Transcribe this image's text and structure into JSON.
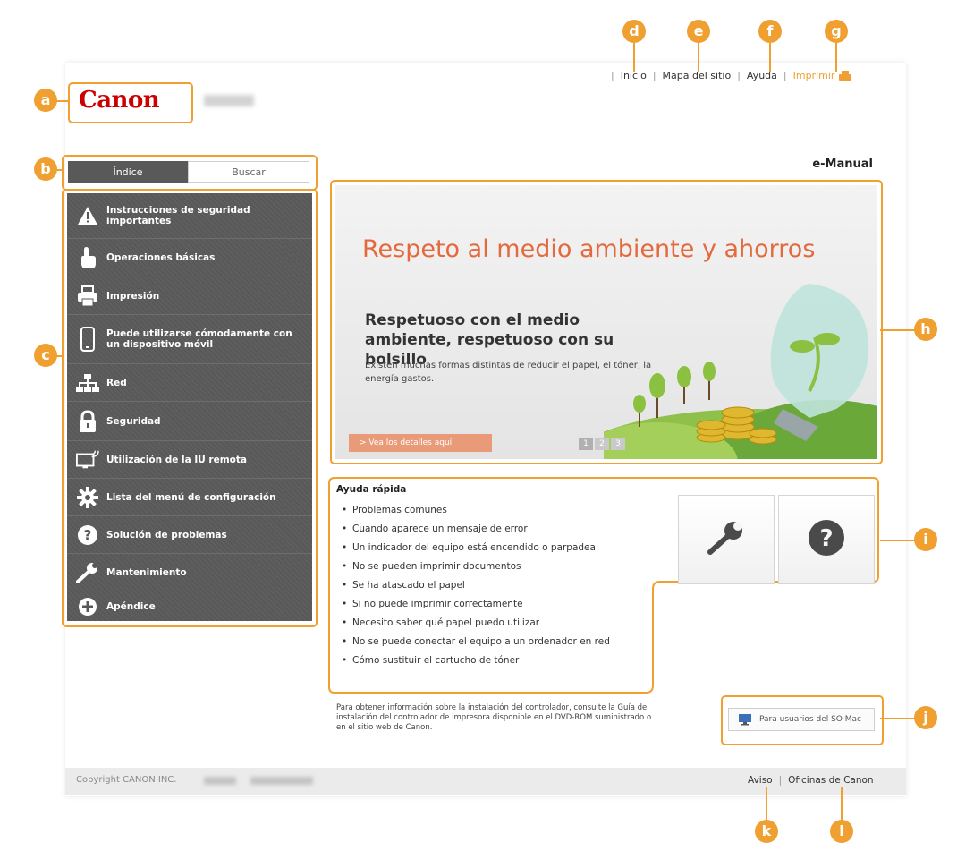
{
  "header": {
    "nav": [
      "Inicio",
      "Mapa del sitio",
      "Ayuda"
    ],
    "print_label": "Imprimir",
    "brand": "Canon"
  },
  "tabs": {
    "index": "Índice",
    "search": "Buscar"
  },
  "menu": [
    {
      "label": "Instrucciones de seguridad importantes",
      "icon": "warning-icon"
    },
    {
      "label": "Operaciones básicas",
      "icon": "hand-icon"
    },
    {
      "label": "Impresión",
      "icon": "printer-icon"
    },
    {
      "label": "Puede utilizarse cómodamente con un dispositivo móvil",
      "icon": "mobile-icon"
    },
    {
      "label": "Red",
      "icon": "network-icon"
    },
    {
      "label": "Seguridad",
      "icon": "lock-icon"
    },
    {
      "label": "Utilización de la IU remota",
      "icon": "remote-ui-icon"
    },
    {
      "label": "Lista del menú de configuración",
      "icon": "gear-icon"
    },
    {
      "label": "Solución de problemas",
      "icon": "question-icon"
    },
    {
      "label": "Mantenimiento",
      "icon": "wrench-icon"
    },
    {
      "label": "Apéndice",
      "icon": "plus-icon"
    }
  ],
  "emanual_title": "e-Manual",
  "banner": {
    "headline": "Respeto al medio ambiente y ahorros",
    "subheadline": "Respetuoso con el medio ambiente, respetuoso con su bolsillo",
    "body": "Existen muchas formas distintas de reducir el papel, el tóner, la energía gastos.",
    "details_link": "> Vea los detalles aquí",
    "pages": [
      "1",
      "2",
      "3"
    ]
  },
  "quick_help": {
    "title": "Ayuda rápida",
    "items": [
      "Problemas comunes",
      "Cuando aparece un mensaje de error",
      "Un indicador del equipo está encendido o parpadea",
      "No se pueden imprimir documentos",
      "Se ha atascado el papel",
      "Si no puede imprimir correctamente",
      "Necesito saber qué papel puedo utilizar",
      "No se puede conectar el equipo a un ordenador en red",
      "Cómo sustituir el cartucho de tóner"
    ]
  },
  "driver_note": "Para obtener información sobre la instalación del controlador, consulte la Guía de instalación del controlador de impresora disponible en el DVD-ROM suministrado o en el sitio web de Canon.",
  "mac_button": "Para usuarios del SO Mac",
  "footer": {
    "copyright": "Copyright CANON INC.",
    "links": [
      "Aviso",
      "Oficinas de Canon"
    ]
  },
  "callouts": [
    "a",
    "b",
    "c",
    "d",
    "e",
    "f",
    "g",
    "h",
    "i",
    "j",
    "k",
    "l"
  ],
  "colors": {
    "accent": "#f0a030",
    "menu_bg": "#585858",
    "brand_red": "#cc0000",
    "headline": "#e46a3e"
  }
}
